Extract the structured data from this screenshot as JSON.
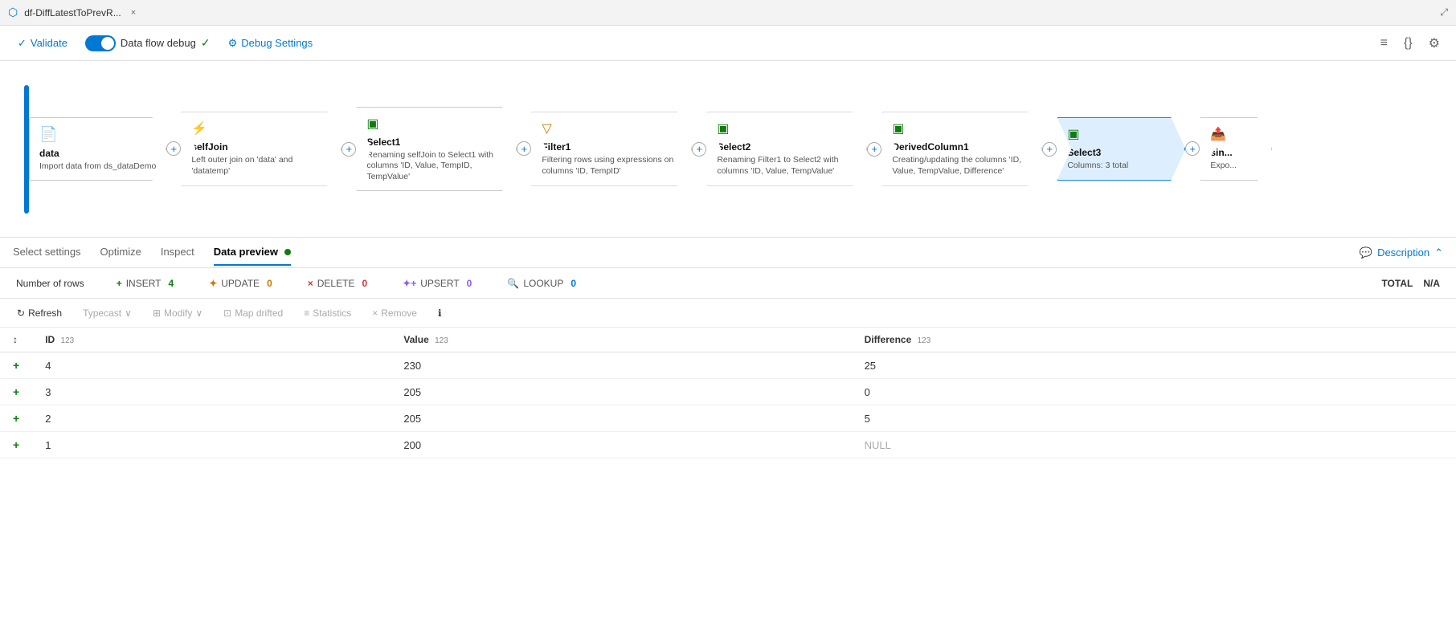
{
  "titleBar": {
    "icon": "⬡",
    "title": "df-DiffLatestToPrevR...",
    "closeLabel": "×",
    "expandIcon": "⤢"
  },
  "toolbar": {
    "validateLabel": "Validate",
    "validateIcon": "✓",
    "debugLabel": "Data flow debug",
    "debugSettingsLabel": "Debug Settings",
    "debugSettingsIcon": "⚙",
    "icons": [
      "≡",
      "{}",
      "⚙"
    ]
  },
  "flow": {
    "nodes": [
      {
        "id": "data",
        "title": "data",
        "desc": "Import data from ds_dataDemo",
        "icon": "📄",
        "iconColor": "#0078d4",
        "selected": false,
        "first": true
      },
      {
        "id": "selfJoin",
        "title": "selfJoin",
        "desc": "Left outer join on 'data' and 'datatemp'",
        "icon": "⚡",
        "iconColor": "#0078d4",
        "selected": false
      },
      {
        "id": "Select1",
        "title": "Select1",
        "desc": "Renaming selfJoin to Select1 with columns 'ID, Value, TempID, TempValue'",
        "icon": "▣",
        "iconColor": "#107c10",
        "selected": false
      },
      {
        "id": "Filter1",
        "title": "Filter1",
        "desc": "Filtering rows using expressions on columns 'ID, TempID'",
        "icon": "▽",
        "iconColor": "#ca7800",
        "selected": false
      },
      {
        "id": "Select2",
        "title": "Select2",
        "desc": "Renaming Filter1 to Select2 with columns 'ID, Value, TempValue'",
        "icon": "▣",
        "iconColor": "#107c10",
        "selected": false
      },
      {
        "id": "DerivedColumn1",
        "title": "DerivedColumn1",
        "desc": "Creating/updating the columns 'ID, Value, TempValue, Difference'",
        "icon": "▣",
        "iconColor": "#107c10",
        "selected": false
      },
      {
        "id": "Select3",
        "title": "Select3",
        "desc": "Columns: 3 total",
        "icon": "▣",
        "iconColor": "#107c10",
        "selected": true
      },
      {
        "id": "sink",
        "title": "sin...",
        "desc": "Expo...",
        "icon": "📤",
        "iconColor": "#0078d4",
        "selected": false,
        "partial": true
      }
    ]
  },
  "tabs": {
    "items": [
      {
        "id": "select-settings",
        "label": "Select settings",
        "active": false
      },
      {
        "id": "optimize",
        "label": "Optimize",
        "active": false
      },
      {
        "id": "inspect",
        "label": "Inspect",
        "active": false
      },
      {
        "id": "data-preview",
        "label": "Data preview",
        "active": true,
        "dot": true
      }
    ],
    "descriptionLabel": "Description"
  },
  "stats": {
    "numRowsLabel": "Number of rows",
    "insert": {
      "label": "INSERT",
      "value": "4",
      "icon": "+"
    },
    "update": {
      "label": "UPDATE",
      "value": "0",
      "icon": "✦"
    },
    "delete": {
      "label": "DELETE",
      "value": "0",
      "icon": "×"
    },
    "upsert": {
      "label": "UPSERT",
      "value": "0",
      "icon": "✦+"
    },
    "lookup": {
      "label": "LOOKUP",
      "value": "0",
      "icon": "🔍"
    },
    "total": {
      "label": "TOTAL",
      "value": "N/A"
    }
  },
  "actionBar": {
    "refreshLabel": "Refresh",
    "typeCastLabel": "Typecast",
    "modifyLabel": "Modify",
    "mapDriftedLabel": "Map drifted",
    "statisticsLabel": "Statistics",
    "removeLabel": "Remove",
    "infoIcon": "ℹ"
  },
  "table": {
    "columns": [
      {
        "name": "ID",
        "type": "123"
      },
      {
        "name": "Value",
        "type": "123"
      },
      {
        "name": "Difference",
        "type": "123"
      }
    ],
    "rows": [
      {
        "marker": "+",
        "id": "4",
        "value": "230",
        "difference": "25",
        "nullDiff": false
      },
      {
        "marker": "+",
        "id": "3",
        "value": "205",
        "difference": "0",
        "nullDiff": false
      },
      {
        "marker": "+",
        "id": "2",
        "value": "205",
        "difference": "5",
        "nullDiff": false
      },
      {
        "marker": "+",
        "id": "1",
        "value": "200",
        "difference": "NULL",
        "nullDiff": true
      }
    ]
  }
}
